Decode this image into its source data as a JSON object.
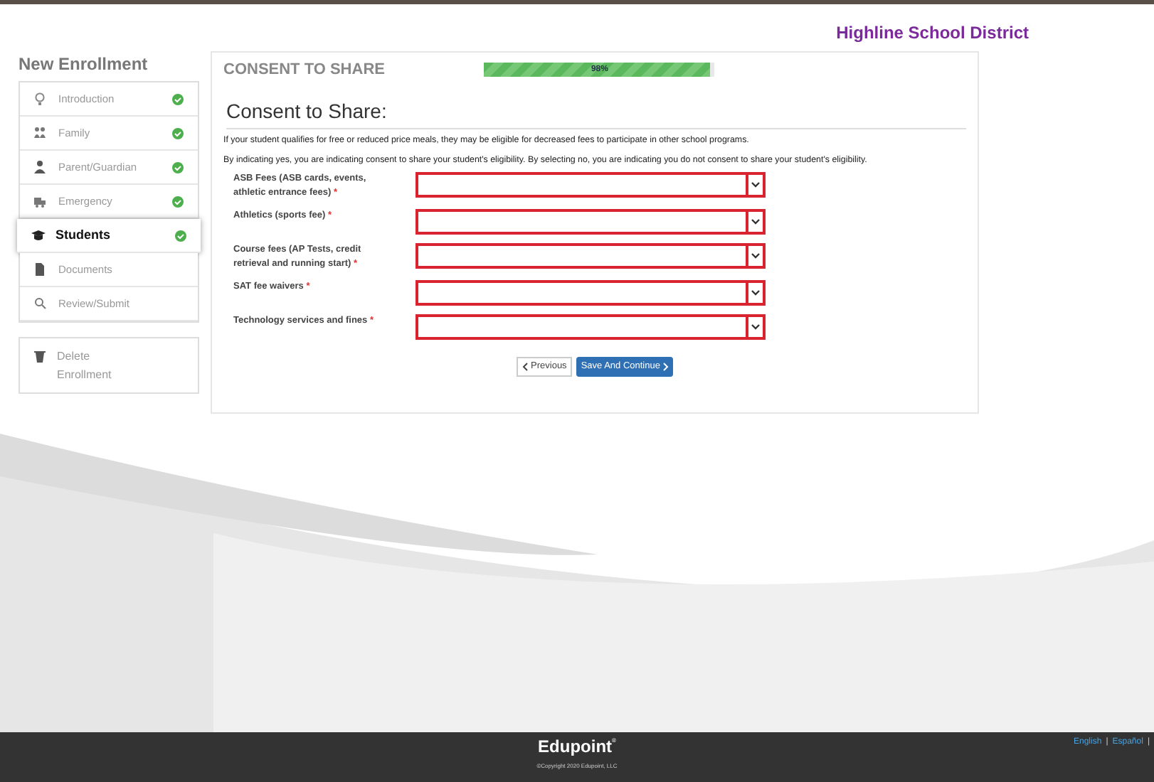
{
  "header": {
    "district": "Highline School District"
  },
  "sidebar": {
    "title": "New Enrollment",
    "items": [
      {
        "kind": "bulb",
        "label": "Introduction",
        "selected": false,
        "complete": true
      },
      {
        "kind": "family",
        "label": "Family",
        "selected": false,
        "complete": true
      },
      {
        "kind": "person",
        "label": "Parent/Guardian",
        "selected": false,
        "complete": true
      },
      {
        "kind": "truck",
        "label": "Emergency",
        "selected": false,
        "complete": true
      },
      {
        "kind": "cap",
        "label": "Students",
        "selected": true,
        "complete": true
      },
      {
        "kind": "file",
        "label": "Documents",
        "selected": false,
        "complete": false
      },
      {
        "kind": "search",
        "label": "Review/Submit",
        "selected": false,
        "complete": false
      }
    ],
    "delete": "Delete Enrollment"
  },
  "main": {
    "section": "CONSENT TO SHARE",
    "progress": {
      "level": 0.98,
      "reading": "98%"
    },
    "heading": "Consent to Share:",
    "paragraphs": [
      "If your student qualifies for free or reduced price meals, they may be eligible for decreased fees to participate in other school programs.",
      "By indicating yes, you are indicating consent to share your student's eligibility. By selecting no, you are indicating you do not consent to share your student's eligibility."
    ],
    "fields": [
      {
        "label": "ASB Fees (ASB cards, events, athletic entrance fees)",
        "required": true
      },
      {
        "label": "Athletics (sports fee)",
        "required": true
      },
      {
        "label": "Course fees (AP Tests, credit retrieval and running start)",
        "required": true
      },
      {
        "label": "SAT fee waivers",
        "required": true
      },
      {
        "label": "Technology services and fines",
        "required": true
      }
    ],
    "required_mark": "*",
    "buttons": {
      "previous": "Previous",
      "next": "Save And Continue"
    }
  },
  "footer": {
    "brand": "Edupoint",
    "trademark": "®",
    "copyright": "©Copyright 2020 Edupoint, LLC",
    "languages": [
      "English",
      "Español"
    ],
    "separator": "|"
  }
}
